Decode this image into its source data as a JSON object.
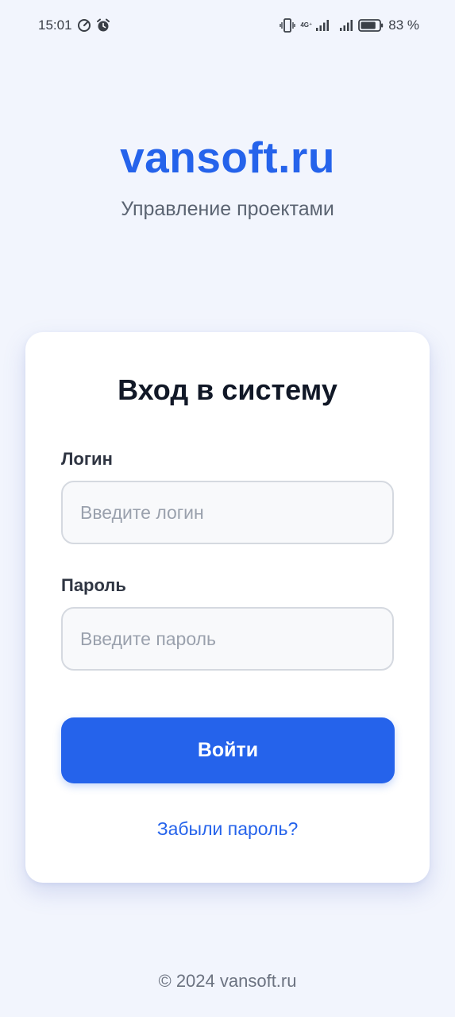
{
  "status_bar": {
    "time": "15:01",
    "network_label": "4G⁺",
    "battery_percent": "83 %",
    "battery_level": 0.83,
    "icons": [
      "speedometer-icon",
      "alarm-icon",
      "vibrate-icon",
      "signal-icon",
      "signal-icon",
      "battery-icon"
    ]
  },
  "brand": {
    "title": "vansoft.ru",
    "subtitle": "Управление проектами",
    "accent_color": "#2563eb"
  },
  "login_card": {
    "title": "Вход в систему",
    "login_label": "Логин",
    "login_placeholder": "Введите логин",
    "login_value": "",
    "password_label": "Пароль",
    "password_placeholder": "Введите пароль",
    "password_value": "",
    "submit_label": "Войти",
    "forgot_link": "Забыли пароль?"
  },
  "footer": {
    "copyright": "© 2024 vansoft.ru"
  }
}
